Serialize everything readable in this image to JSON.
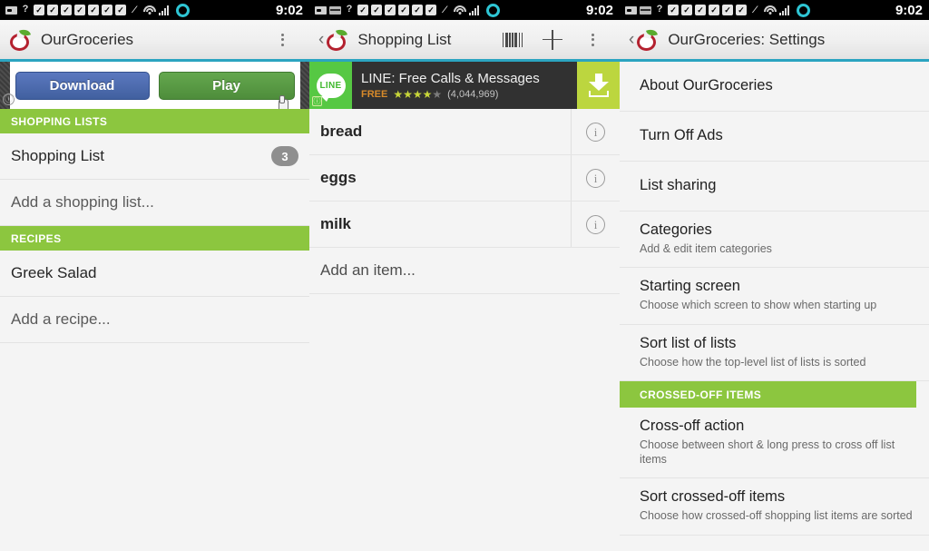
{
  "statusbar": {
    "time": "9:02",
    "icons": [
      "sms-icon",
      "mail-icon",
      "question-icon",
      "task-icon",
      "task-icon",
      "task-icon",
      "task-icon",
      "task-icon",
      "task-icon",
      "mute-icon",
      "wifi-icon",
      "signal-icon",
      "battery-icon"
    ],
    "question_glyph": "?",
    "task_glyph": "✓",
    "mute_glyph": "⁄"
  },
  "colors": {
    "accent_green": "#8cc63f",
    "actionbar_underline": "#2ba4c0",
    "badge_gray": "#8f8f8f",
    "panel_bg": "#f4f4f4",
    "ad_bg": "#313131",
    "ad_download_bg": "#bcd63f",
    "line_green": "#56c843"
  },
  "panels": {
    "left": {
      "actionbar": {
        "title": "OurGroceries",
        "logo": "ourgroceries-apple-logo",
        "overflow": "overflow-menu-icon"
      },
      "promo": {
        "download_label": "Download",
        "play_label": "Play",
        "adchoices_glyph": "ⓘ"
      },
      "sections": [
        {
          "header": "SHOPPING LISTS",
          "rows": [
            {
              "label": "Shopping List",
              "badge": "3",
              "muted": false
            },
            {
              "label": "Add a shopping list...",
              "badge": "",
              "muted": true
            }
          ]
        },
        {
          "header": "RECIPES",
          "rows": [
            {
              "label": "Greek Salad",
              "badge": "",
              "muted": false
            },
            {
              "label": "Add a recipe...",
              "badge": "",
              "muted": true
            }
          ]
        }
      ]
    },
    "middle": {
      "actionbar": {
        "title": "Shopping List",
        "back": "‹",
        "barcode": "barcode-scanner-icon",
        "plus": "add-item-icon",
        "overflow": "overflow-menu-icon"
      },
      "ad": {
        "icon_label": "LINE",
        "title": "LINE: Free Calls & Messages",
        "price": "FREE",
        "stars_filled": "★★★★",
        "stars_empty": "★",
        "rating_count": "(4,044,969)",
        "adchoices_glyph": "ⓘ",
        "download": "download-arrow-icon"
      },
      "items": [
        {
          "label": "bread",
          "info": "info-icon"
        },
        {
          "label": "eggs",
          "info": "info-icon"
        },
        {
          "label": "milk",
          "info": "info-icon"
        }
      ],
      "add_item_label": "Add an item..."
    },
    "right": {
      "actionbar": {
        "title": "OurGroceries: Settings",
        "back": "‹"
      },
      "settings": [
        {
          "title": "About OurGroceries",
          "subtitle": "",
          "type": "simple"
        },
        {
          "title": "Turn Off Ads",
          "subtitle": "",
          "type": "simple"
        },
        {
          "title": "List sharing",
          "subtitle": "",
          "type": "simple"
        },
        {
          "title": "Categories",
          "subtitle": "Add & edit item categories",
          "type": "detail"
        },
        {
          "title": "Starting screen",
          "subtitle": "Choose which screen to show when starting up",
          "type": "detail"
        },
        {
          "title": "Sort list of lists",
          "subtitle": "Choose how the top-level list of lists is sorted",
          "type": "detail"
        }
      ],
      "section_header": "CROSSED-OFF ITEMS",
      "settings2": [
        {
          "title": "Cross-off action",
          "subtitle": "Choose between short & long press to cross off list items",
          "type": "detail"
        },
        {
          "title": "Sort crossed-off items",
          "subtitle": "Choose how crossed-off shopping list items are sorted",
          "type": "detail"
        }
      ]
    }
  }
}
